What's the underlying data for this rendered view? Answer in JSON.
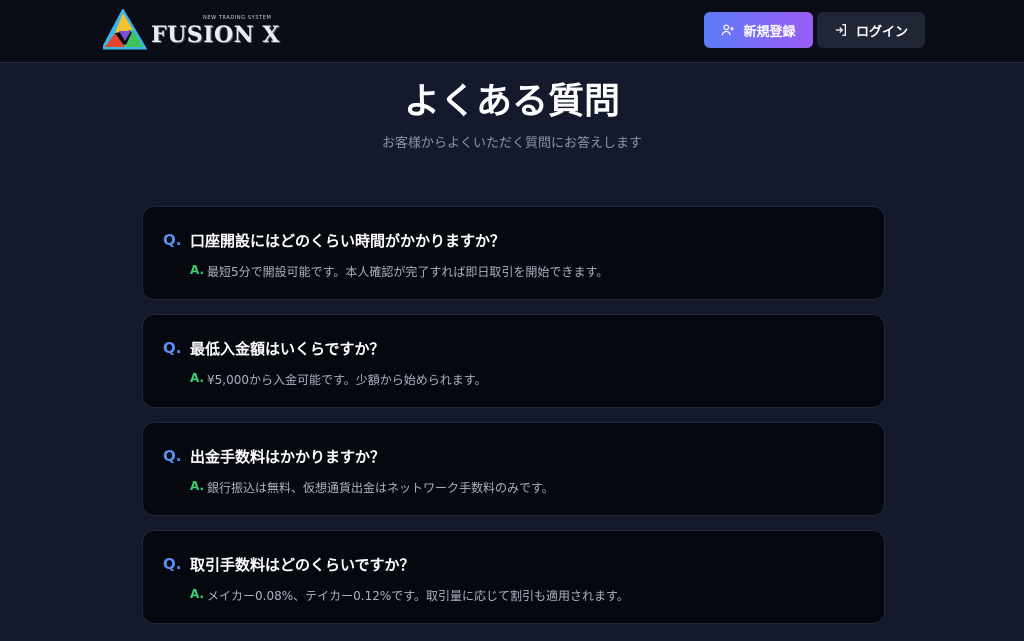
{
  "header": {
    "logo_text": "FUSION X",
    "logo_tagline": "NEW TRADING SYSTEM",
    "register_label": "新規登録",
    "login_label": "ログイン"
  },
  "page": {
    "title": "よくある質問",
    "subtitle": "お客様からよくいただく質問にお答えします"
  },
  "faq": {
    "q_marker": "Q.",
    "a_marker": "A.",
    "items": [
      {
        "question": "口座開設にはどのくらい時間がかかりますか？",
        "answer": "最短5分で開設可能です。本人確認が完了すれば即日取引を開始できます。"
      },
      {
        "question": "最低入金額はいくらですか？",
        "answer": "¥5,000から入金可能です。少額から始められます。"
      },
      {
        "question": "出金手数料はかかりますか？",
        "answer": "銀行振込は無料、仮想通貨出金はネットワーク手数料のみです。"
      },
      {
        "question": "取引手数料はどのくらいですか？",
        "answer": "メイカー0.08%、テイカー0.12%です。取引量に応じて割引も適用されます。"
      }
    ]
  },
  "colors": {
    "background": "#141a2b",
    "header": "#0a0d16",
    "card": "#060810",
    "question_marker": "#5b8ff0",
    "answer_marker": "#3ecf6a",
    "register_gradient_start": "#5b7cf7",
    "register_gradient_end": "#9b5cf3"
  },
  "icons": {
    "logo": "triangle-logo-icon",
    "register": "user-plus-icon",
    "login": "login-arrow-icon"
  }
}
